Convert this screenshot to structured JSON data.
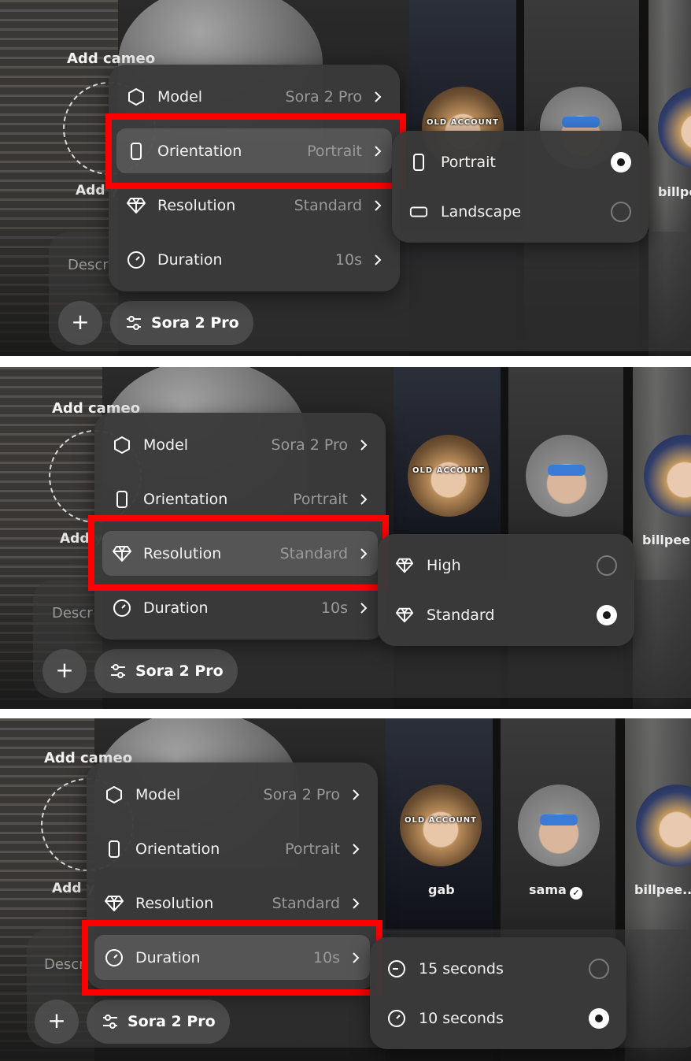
{
  "add_cameo_title": "Add cameo",
  "add_you_label": "Add y",
  "describe_placeholder": "Descr",
  "plus_label": "+",
  "model_button_label": "Sora 2 Pro",
  "cameos": {
    "gab": "gab",
    "sama": "sama",
    "billpee": "billpee...",
    "old_account": "OLD ACCOUNT",
    "verified_mark": "✓"
  },
  "menu": {
    "model": {
      "label": "Model",
      "value": "Sora 2 Pro"
    },
    "orientation": {
      "label": "Orientation",
      "value": "Portrait"
    },
    "resolution": {
      "label": "Resolution",
      "value": "Standard"
    },
    "duration": {
      "label": "Duration",
      "value": "10s"
    }
  },
  "submenus": {
    "orientation": [
      {
        "label": "Portrait",
        "selected": true
      },
      {
        "label": "Landscape",
        "selected": false
      }
    ],
    "resolution": [
      {
        "label": "High",
        "selected": false
      },
      {
        "label": "Standard",
        "selected": true
      }
    ],
    "duration": [
      {
        "label": "15 seconds",
        "selected": false
      },
      {
        "label": "10 seconds",
        "selected": true
      }
    ]
  },
  "colors": {
    "highlight": "#ff0000",
    "menu_bg": "#3a3a3a",
    "muted": "#9a9a9a"
  },
  "icons": [
    "hexagon-icon",
    "phone-portrait-icon",
    "diamond-icon",
    "clock-icon",
    "chevron-right-icon",
    "landscape-icon",
    "sliders-icon",
    "plus-icon"
  ]
}
